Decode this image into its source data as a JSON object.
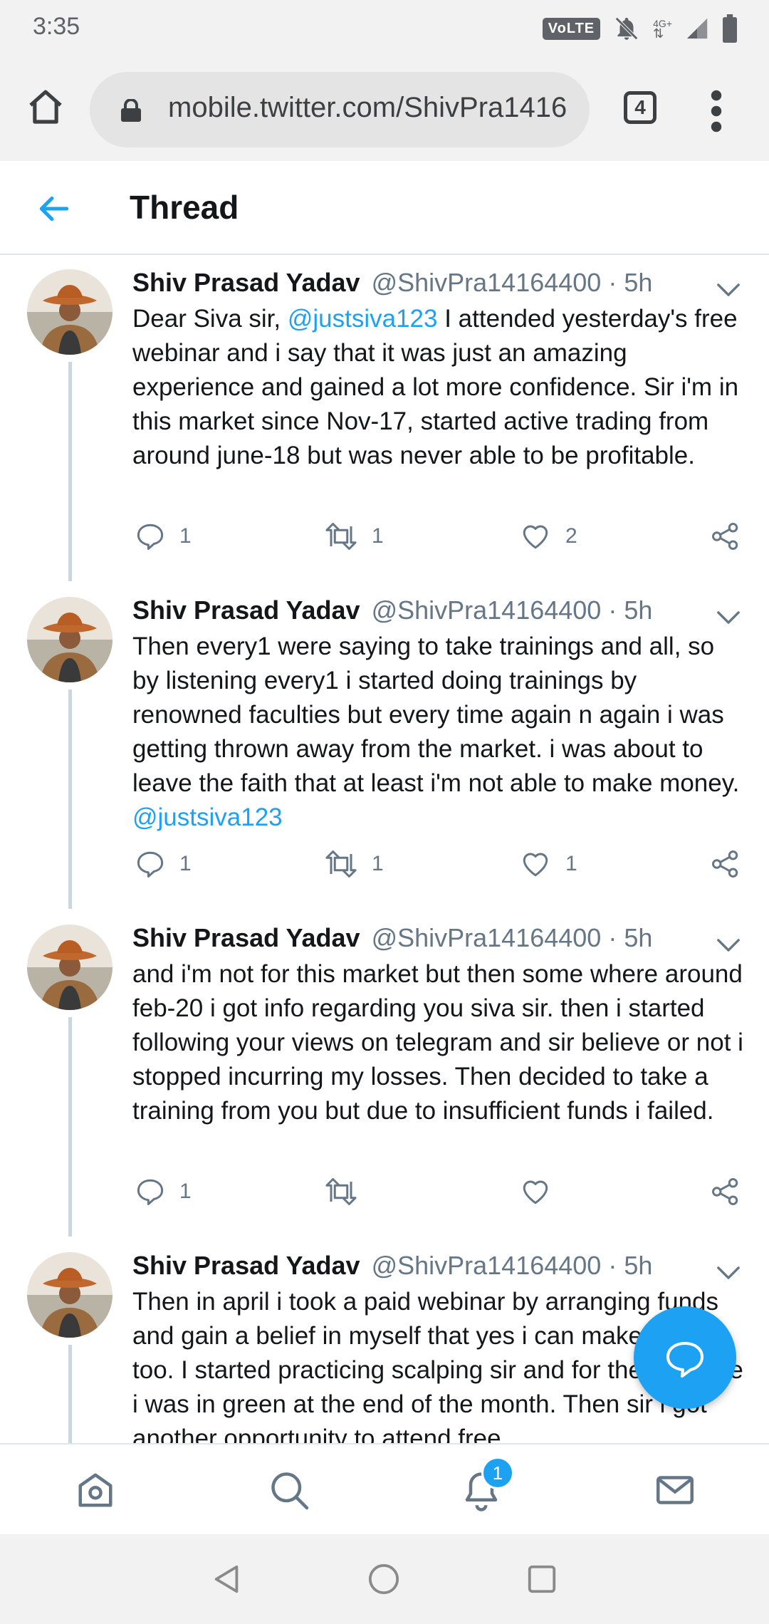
{
  "status_bar": {
    "time": "3:35",
    "volte": "VoLTE",
    "network": "4G+"
  },
  "browser": {
    "url": "mobile.twitter.com/ShivPra14164400",
    "tab_count": "4"
  },
  "header": {
    "title": "Thread"
  },
  "tweets": [
    {
      "name": "Shiv Prasad Yadav",
      "handle": "@ShivPra14164400 · 5h",
      "text_before": "Dear Siva sir, ",
      "mention1": "@justsiva123",
      "text_after": " I attended yesterday's free webinar and i say that it was just an amazing experience and gained a lot more confidence. Sir i'm in this market since Nov-17, started active trading from around june-18 but was never able to be profitable.",
      "mention2": "",
      "replies": "1",
      "retweets": "1",
      "likes": "2"
    },
    {
      "name": "Shiv Prasad Yadav",
      "handle": "@ShivPra14164400 · 5h",
      "text_before": "Then every1 were saying to take trainings and all, so by listening every1 i started doing trainings by renowned faculties but every time again n again i was getting thrown away from the market. i was about to leave the faith that at least i'm not able to make money. ",
      "mention1": "",
      "text_after": "",
      "mention2": "@justsiva123",
      "replies": "1",
      "retweets": "1",
      "likes": "1"
    },
    {
      "name": "Shiv Prasad Yadav",
      "handle": "@ShivPra14164400 · 5h",
      "text_before": "and i'm not for this market but then some where around feb-20 i got info regarding you siva sir. then i started following your views on telegram and sir believe or not i stopped incurring my losses. Then decided to take a training from you but due to insufficient funds i failed.",
      "mention1": "",
      "text_after": "",
      "mention2": "",
      "replies": "1",
      "retweets": "",
      "likes": ""
    },
    {
      "name": "Shiv Prasad Yadav",
      "handle": "@ShivPra14164400 · 5h",
      "text_before": "Then in april i took a paid webinar by arranging funds and gain a belief in myself that yes i can make money too. I started practicing scalping sir and for the first time i was in green at the end of the month. Then sir i got another opportunity to attend free",
      "mention1": "",
      "text_after": "",
      "mention2": "",
      "replies": "",
      "retweets": "",
      "likes": ""
    }
  ],
  "bottom_nav": {
    "notification_badge": "1"
  },
  "colors": {
    "accent": "#1da1f2",
    "text": "#14171a",
    "secondary": "#657786",
    "divider": "#e1e8ed"
  },
  "icons": [
    "home-icon",
    "lock-icon",
    "tabs-icon",
    "more-vert-icon",
    "back-arrow-icon",
    "caret-down-icon",
    "reply-icon",
    "retweet-icon",
    "like-icon",
    "share-icon",
    "nav-home-icon",
    "nav-search-icon",
    "nav-notifications-icon",
    "nav-messages-icon",
    "compose-icon"
  ]
}
